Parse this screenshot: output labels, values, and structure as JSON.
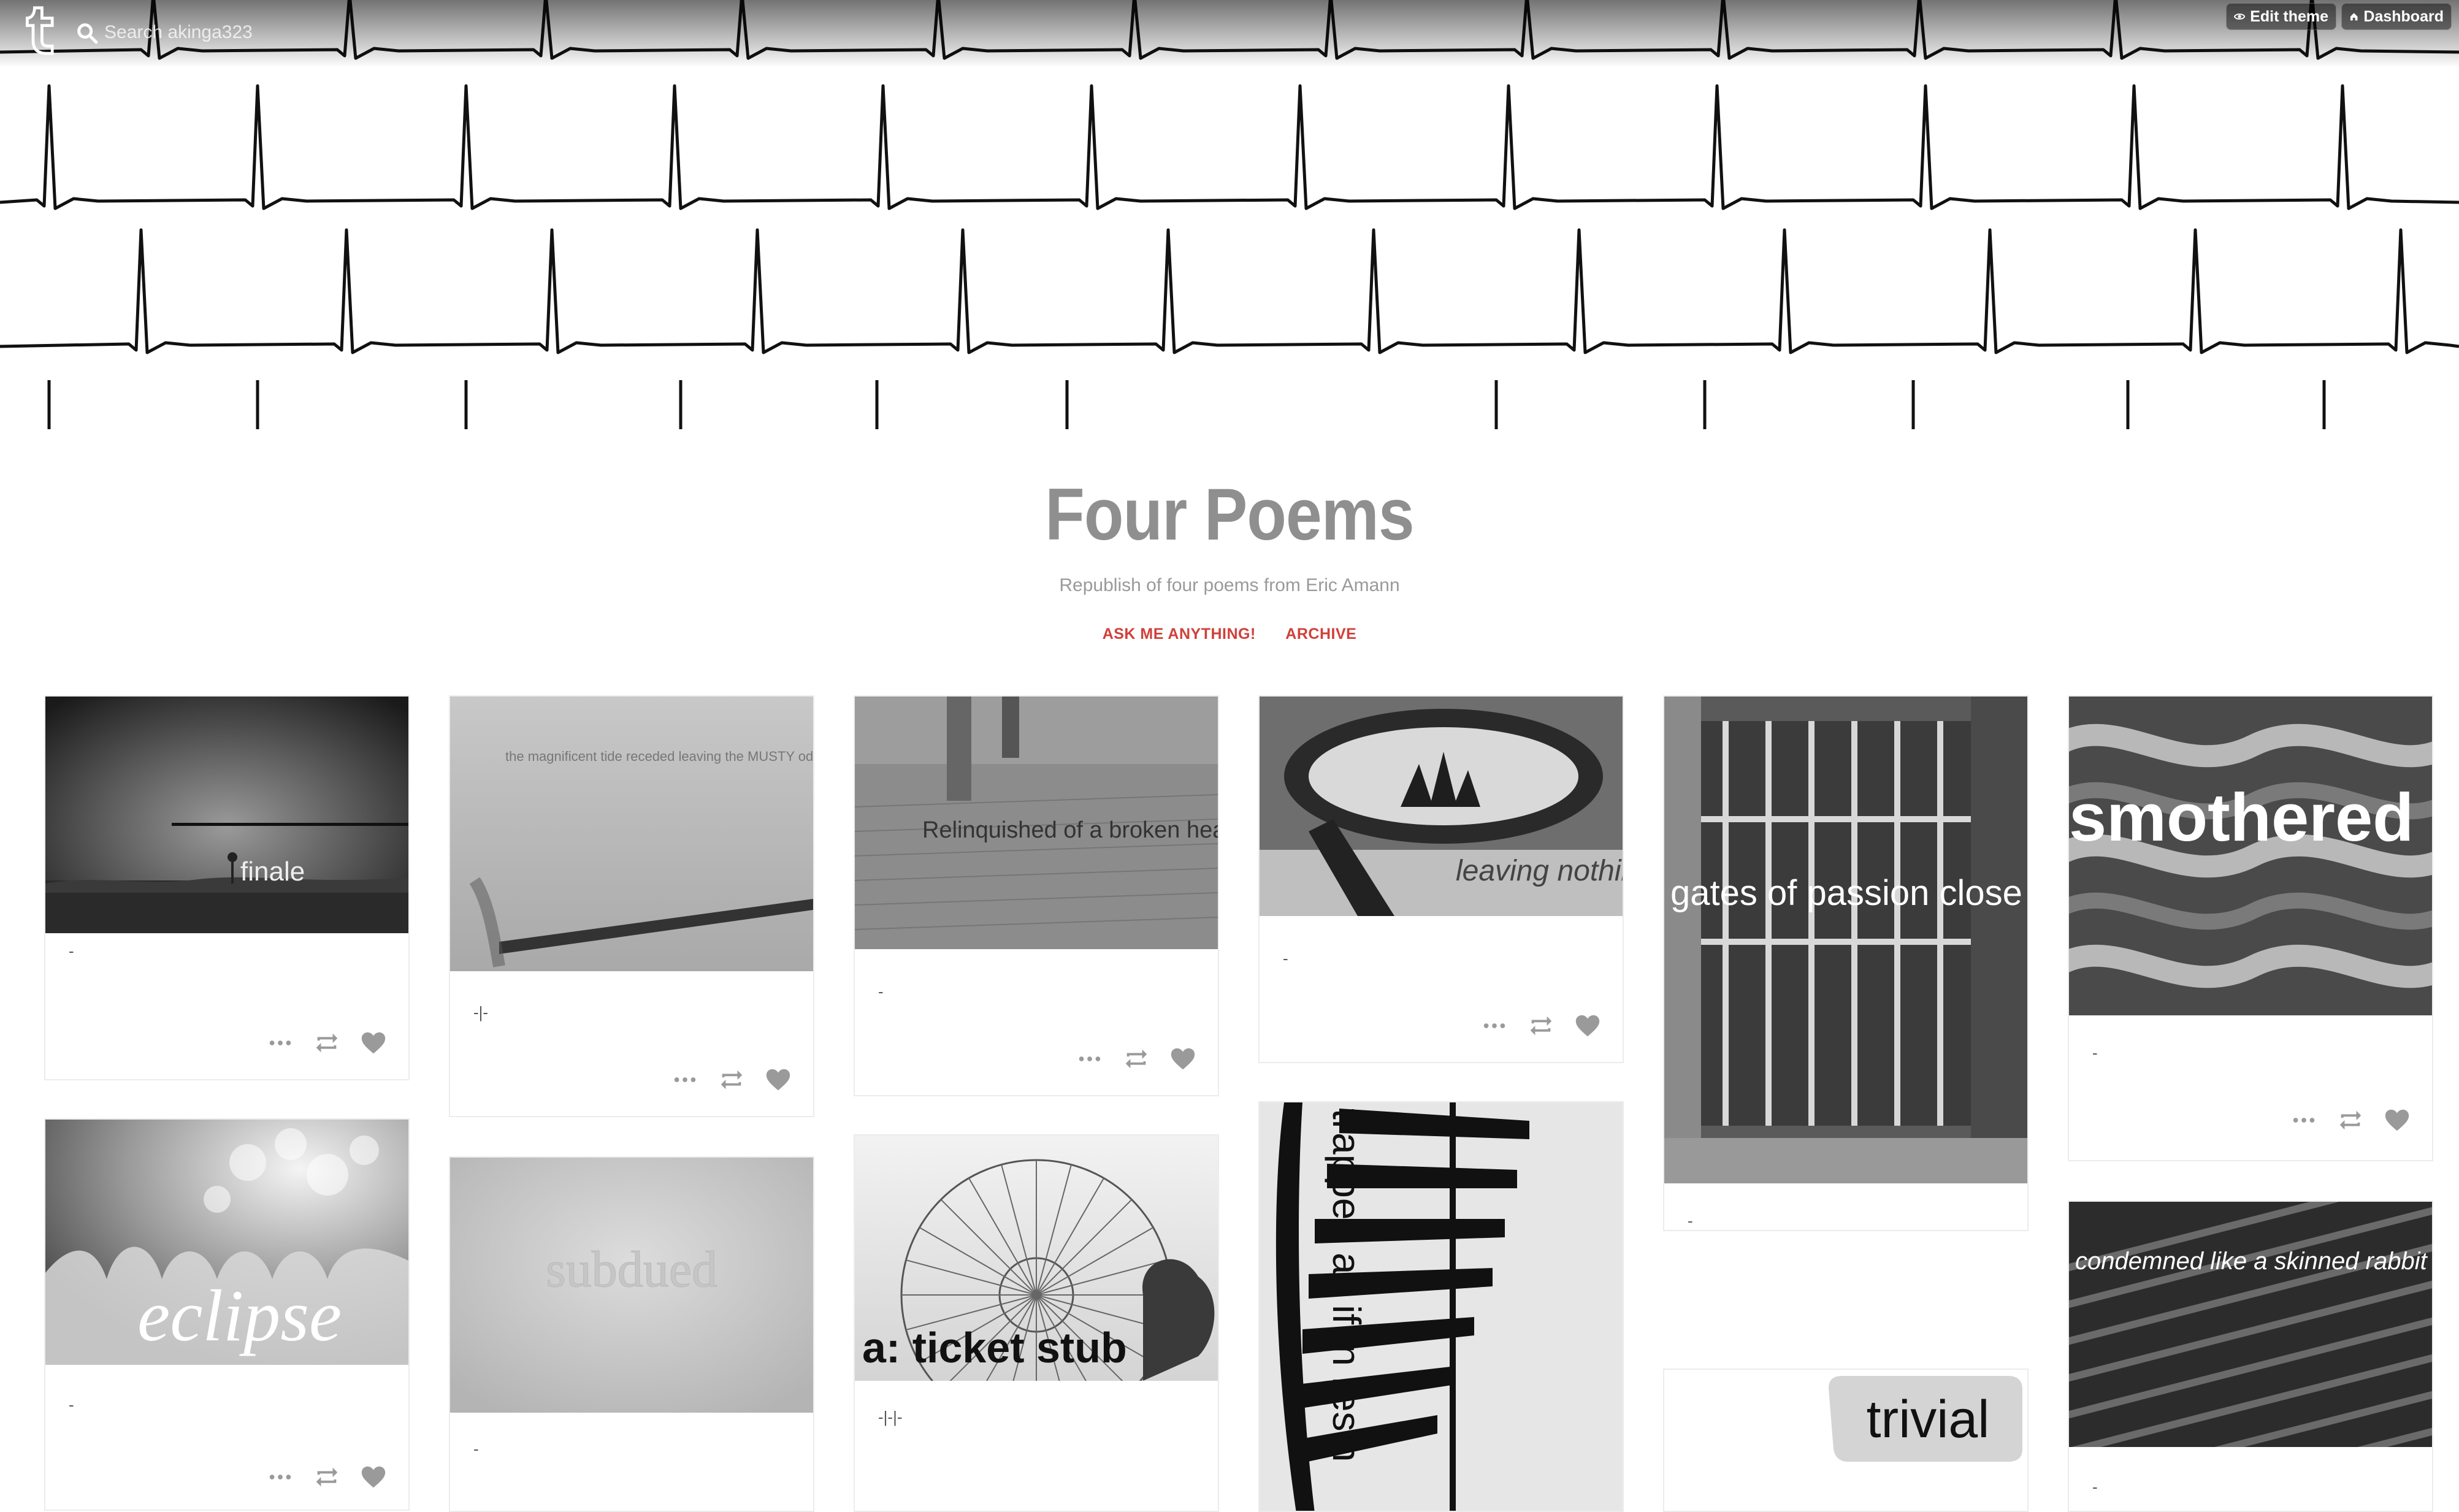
{
  "topbar": {
    "search_placeholder": "Search akinga323",
    "edit_theme_label": "Edit theme",
    "dashboard_label": "Dashboard"
  },
  "blog": {
    "title": "Four Poems",
    "description": "Republish of four poems from Eric Amann",
    "nav": [
      "ASK ME ANYTHING!",
      "ARCHIVE"
    ]
  },
  "colors": {
    "accent": "#d0403a",
    "title": "#8f8f8f",
    "icon": "#9a9a9a"
  },
  "posts": [
    {
      "image_text": "finale",
      "caption": "-"
    },
    {
      "image_text": "the magnificent tide receded leaving the MUSTY odor of cold ashes",
      "caption": "-|-"
    },
    {
      "image_text": "Relinquished of a broken heart",
      "caption": "-"
    },
    {
      "image_text": "leaving nothing",
      "caption": "-"
    },
    {
      "image_text": "gates of passion close SILENTLY",
      "caption": "-"
    },
    {
      "image_text": "smothered snuffed out like a candle",
      "caption": "-"
    },
    {
      "image_text": "eclipse",
      "caption": "-"
    },
    {
      "image_text": "subdued",
      "caption": "-"
    },
    {
      "image_text": "a: ticket stub",
      "caption": "-|-|-"
    },
    {
      "image_text": "trapped as if in resin",
      "caption": ""
    },
    {
      "image_text": "trivial",
      "caption": ""
    },
    {
      "image_text": "condemned like a skinned rabbit",
      "caption": "-"
    }
  ],
  "icons": [
    "tumblr-logo-icon",
    "search-icon",
    "eye-icon",
    "home-icon",
    "more-icon",
    "reblog-icon",
    "heart-icon"
  ]
}
